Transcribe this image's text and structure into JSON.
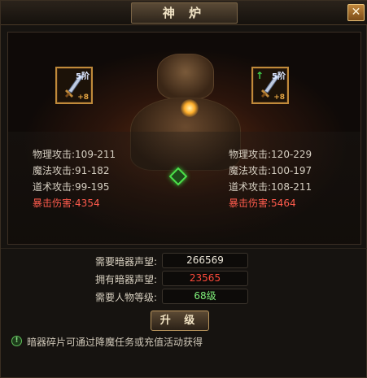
{
  "window": {
    "title": "神 炉",
    "close_label": "✕"
  },
  "left_item": {
    "tier": "5阶",
    "plus": "+8",
    "icon": "sword-icon"
  },
  "right_item": {
    "tier": "5阶",
    "plus": "+8",
    "icon": "sword-icon",
    "upgrade_arrow": "↑"
  },
  "stats": {
    "labels": [
      "物理攻击:",
      "魔法攻击:",
      "道术攻击:",
      "暴击伤害:"
    ],
    "current": [
      "109-211",
      "91-182",
      "99-195",
      "4354"
    ],
    "next": [
      "120-229",
      "100-197",
      "108-211",
      "5464"
    ]
  },
  "requirements": [
    {
      "label": "需要暗器声望:",
      "value": "266569",
      "color": "white"
    },
    {
      "label": "拥有暗器声望:",
      "value": "23565",
      "color": "red"
    },
    {
      "label": "需要人物等级:",
      "value": "68级",
      "color": "green"
    }
  ],
  "upgrade_button": "升 级",
  "hint": {
    "icon_glyph": "!",
    "text": "暗器碎片可通过降魔任务或充值活动获得"
  },
  "colors": {
    "accent_gold": "#c08a3a",
    "crit_red": "#ff5b4d",
    "owned_red": "#ff4a3a",
    "level_green": "#7ff07a"
  }
}
